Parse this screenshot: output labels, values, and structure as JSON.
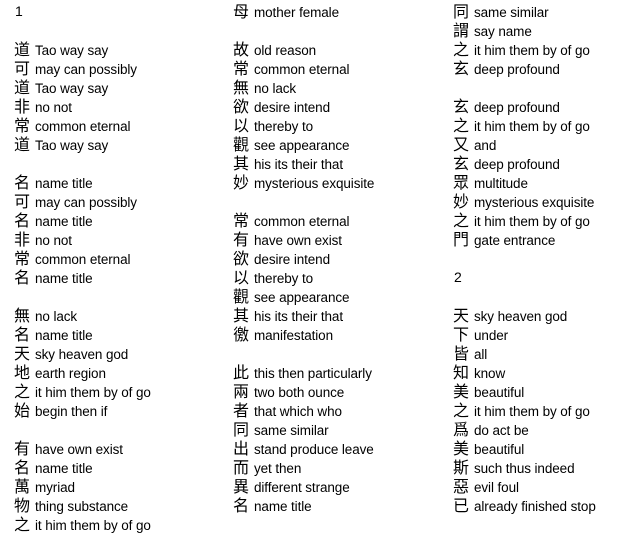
{
  "document": {
    "title": "Tao Te Ching character-by-character glossary",
    "background_color": "#ffffff",
    "text_color": "#000000"
  },
  "columns": [
    {
      "id": "column-1",
      "blocks": [
        {
          "type": "chapter",
          "label": "1"
        },
        {
          "type": "spacer"
        },
        {
          "type": "group",
          "entries": [
            {
              "char": "道",
              "gloss": "Tao way say"
            },
            {
              "char": "可",
              "gloss": "may can possibly"
            },
            {
              "char": "道",
              "gloss": "Tao way say"
            },
            {
              "char": "非",
              "gloss": "no not"
            },
            {
              "char": "常",
              "gloss": "common eternal"
            },
            {
              "char": "道",
              "gloss": "Tao way say"
            }
          ]
        },
        {
          "type": "spacer"
        },
        {
          "type": "group",
          "entries": [
            {
              "char": "名",
              "gloss": "name title"
            },
            {
              "char": "可",
              "gloss": "may can possibly"
            },
            {
              "char": "名",
              "gloss": "name title"
            },
            {
              "char": "非",
              "gloss": "no not"
            },
            {
              "char": "常",
              "gloss": "common eternal"
            },
            {
              "char": "名",
              "gloss": "name title"
            }
          ]
        },
        {
          "type": "spacer"
        },
        {
          "type": "group",
          "entries": [
            {
              "char": "無",
              "gloss": "no lack"
            },
            {
              "char": "名",
              "gloss": "name title"
            },
            {
              "char": "天",
              "gloss": "sky heaven god"
            },
            {
              "char": "地",
              "gloss": "earth region"
            },
            {
              "char": "之",
              "gloss": "it him them by of go"
            },
            {
              "char": "始",
              "gloss": "begin then if"
            }
          ]
        },
        {
          "type": "spacer"
        },
        {
          "type": "group",
          "entries": [
            {
              "char": "有",
              "gloss": "have own exist"
            },
            {
              "char": "名",
              "gloss": "name title"
            },
            {
              "char": "萬",
              "gloss": "myriad"
            },
            {
              "char": "物",
              "gloss": "thing substance"
            },
            {
              "char": "之",
              "gloss": "it him them by of go"
            }
          ]
        }
      ]
    },
    {
      "id": "column-2",
      "blocks": [
        {
          "type": "group",
          "entries": [
            {
              "char": "母",
              "gloss": "mother female"
            }
          ]
        },
        {
          "type": "spacer"
        },
        {
          "type": "group",
          "entries": [
            {
              "char": "故",
              "gloss": "old reason"
            },
            {
              "char": "常",
              "gloss": "common eternal"
            },
            {
              "char": "無",
              "gloss": "no lack"
            },
            {
              "char": "欲",
              "gloss": "desire intend"
            },
            {
              "char": "以",
              "gloss": "thereby to"
            },
            {
              "char": "觀",
              "gloss": "see appearance"
            },
            {
              "char": "其",
              "gloss": "his its their that"
            },
            {
              "char": "妙",
              "gloss": "mysterious exquisite"
            }
          ]
        },
        {
          "type": "spacer"
        },
        {
          "type": "group",
          "entries": [
            {
              "char": "常",
              "gloss": "common eternal"
            },
            {
              "char": "有",
              "gloss": "have own exist"
            },
            {
              "char": "欲",
              "gloss": "desire intend"
            },
            {
              "char": "以",
              "gloss": "thereby to"
            },
            {
              "char": "觀",
              "gloss": "see appearance"
            },
            {
              "char": "其",
              "gloss": "his its their that"
            },
            {
              "char": "徼",
              "gloss": "manifestation"
            }
          ]
        },
        {
          "type": "spacer"
        },
        {
          "type": "group",
          "entries": [
            {
              "char": "此",
              "gloss": "this then particularly"
            },
            {
              "char": "兩",
              "gloss": "two both ounce"
            },
            {
              "char": "者",
              "gloss": "that which who"
            },
            {
              "char": "同",
              "gloss": "same similar"
            },
            {
              "char": "出",
              "gloss": "stand produce leave"
            },
            {
              "char": "而",
              "gloss": "yet then"
            },
            {
              "char": "異",
              "gloss": "different strange"
            },
            {
              "char": "名",
              "gloss": "name title"
            }
          ]
        }
      ]
    },
    {
      "id": "column-3",
      "blocks": [
        {
          "type": "group",
          "entries": [
            {
              "char": "同",
              "gloss": "same similar"
            },
            {
              "char": "謂",
              "gloss": "say name"
            },
            {
              "char": "之",
              "gloss": "it him them by of go"
            },
            {
              "char": "玄",
              "gloss": "deep profound"
            }
          ]
        },
        {
          "type": "spacer"
        },
        {
          "type": "group",
          "entries": [
            {
              "char": "玄",
              "gloss": "deep profound"
            },
            {
              "char": "之",
              "gloss": "it him them by of go"
            },
            {
              "char": "又",
              "gloss": "and"
            },
            {
              "char": "玄",
              "gloss": "deep profound"
            },
            {
              "char": "眾",
              "gloss": "multitude"
            },
            {
              "char": "妙",
              "gloss": "mysterious exquisite"
            },
            {
              "char": "之",
              "gloss": "it him them by of go"
            },
            {
              "char": "門",
              "gloss": "gate entrance"
            }
          ]
        },
        {
          "type": "spacer"
        },
        {
          "type": "chapter",
          "label": "2"
        },
        {
          "type": "spacer"
        },
        {
          "type": "group",
          "entries": [
            {
              "char": "天",
              "gloss": "sky heaven god"
            },
            {
              "char": "下",
              "gloss": "under"
            },
            {
              "char": "皆",
              "gloss": "all"
            },
            {
              "char": "知",
              "gloss": "know"
            },
            {
              "char": "美",
              "gloss": "beautiful"
            },
            {
              "char": "之",
              "gloss": "it him them by of go"
            },
            {
              "char": "爲",
              "gloss": "do act be"
            },
            {
              "char": "美",
              "gloss": "beautiful"
            },
            {
              "char": "斯",
              "gloss": "such thus indeed"
            },
            {
              "char": "惡",
              "gloss": "evil foul"
            },
            {
              "char": "已",
              "gloss": "already finished stop"
            }
          ]
        }
      ]
    }
  ]
}
